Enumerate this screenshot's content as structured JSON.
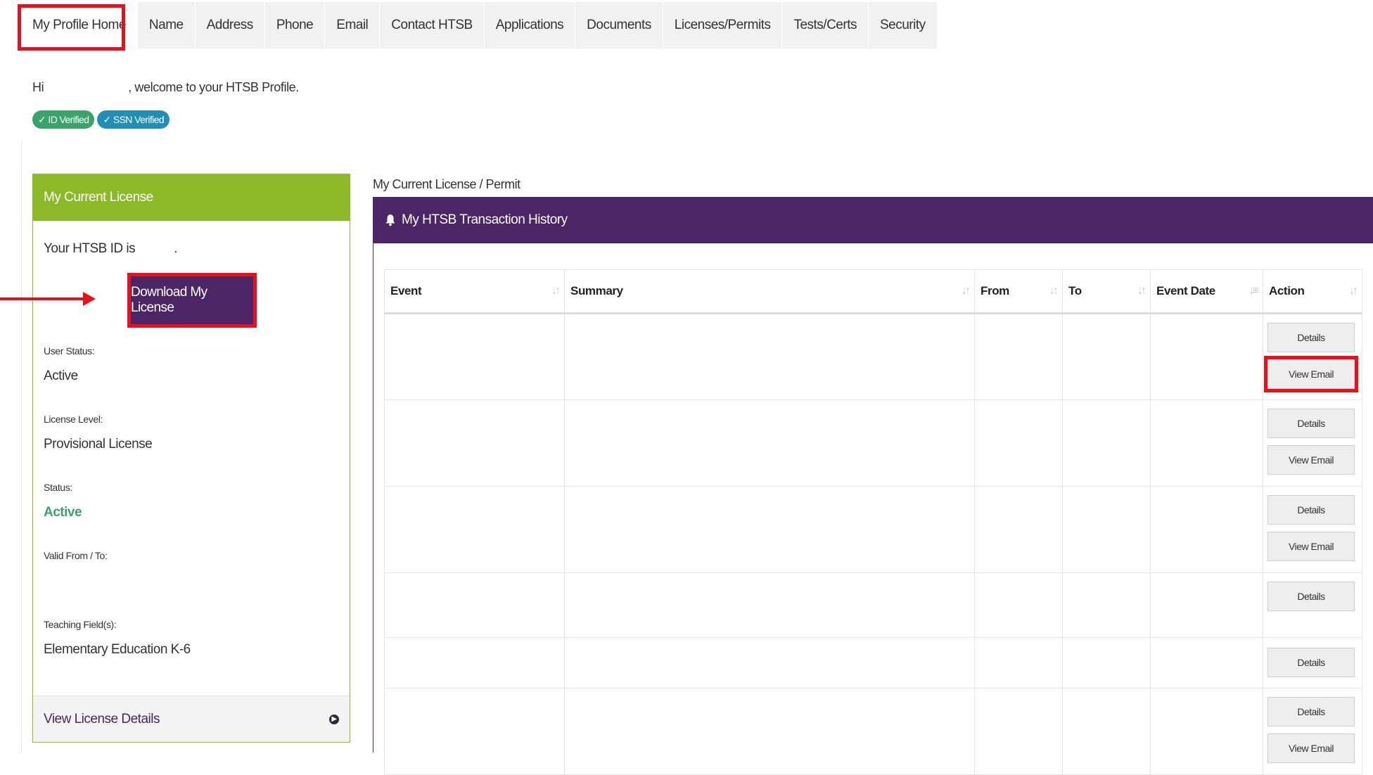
{
  "tabs": [
    {
      "label": "My Profile Home",
      "active": true
    },
    {
      "label": "Name"
    },
    {
      "label": "Address"
    },
    {
      "label": "Phone"
    },
    {
      "label": "Email"
    },
    {
      "label": "Contact HTSB"
    },
    {
      "label": "Applications"
    },
    {
      "label": "Documents"
    },
    {
      "label": "Licenses/Permits"
    },
    {
      "label": "Tests/Certs"
    },
    {
      "label": "Security"
    }
  ],
  "welcome": {
    "greeting": "Hi",
    "message": ", welcome to your HTSB Profile.",
    "badges": [
      "✓ ID Verified",
      "✓ SSN Verified"
    ]
  },
  "license": {
    "header": "My Current License",
    "id_text": "Your HTSB ID is",
    "id_suffix": ".",
    "download_label": "Download My License",
    "user_status_label": "User Status:",
    "user_status": "Active",
    "level_label": "License Level:",
    "level": "Provisional License",
    "status_label": "Status:",
    "status": "Active",
    "valid_label": "Valid From / To:",
    "field_label": "Teaching Field(s):",
    "field": "Elementary Education K-6",
    "footer_link": "View License Details"
  },
  "history": {
    "caption": "My Current License / Permit",
    "header": "My HTSB Transaction History",
    "columns": [
      "Event",
      "Summary",
      "From",
      "To",
      "Event Date",
      "Action"
    ],
    "rows": [
      {
        "actions": [
          "Details",
          "View Email"
        ]
      },
      {
        "actions": [
          "Details",
          "View Email"
        ]
      },
      {
        "actions": [
          "Details",
          "View Email"
        ]
      },
      {
        "actions": [
          "Details"
        ]
      },
      {
        "actions": [
          "Details"
        ]
      },
      {
        "actions": [
          "Details",
          "View Email"
        ]
      }
    ]
  },
  "colors": {
    "accent_purple": "#4b2566",
    "license_green": "#8cb92a",
    "highlight_red": "#e8101a",
    "status_green": "#3aa36a"
  }
}
